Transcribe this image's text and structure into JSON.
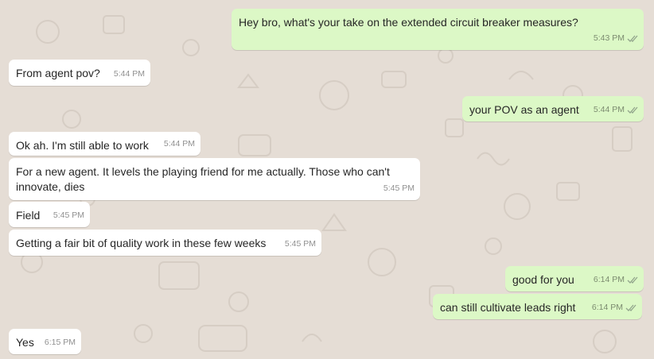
{
  "colors": {
    "background": "#e5ddd5",
    "incoming_bubble": "#ffffff",
    "outgoing_bubble": "#dcf8c6",
    "tick": "#92a58c"
  },
  "messages": [
    {
      "direction": "outgoing",
      "text": "Hey bro, what's your take on the extended circuit breaker measures?",
      "time": "5:43 PM",
      "status_icon": "double-check-icon"
    },
    {
      "direction": "incoming",
      "text": "From agent pov?",
      "time": "5:44 PM"
    },
    {
      "direction": "outgoing",
      "text": "your POV as an agent",
      "time": "5:44 PM",
      "status_icon": "double-check-icon"
    },
    {
      "direction": "incoming",
      "text": "Ok ah. I'm still able to work",
      "time": "5:44 PM"
    },
    {
      "direction": "incoming",
      "text": "For a new agent. It levels the playing friend for me actually. Those who can't innovate, dies",
      "time": "5:45 PM"
    },
    {
      "direction": "incoming",
      "text": "Field",
      "time": "5:45 PM"
    },
    {
      "direction": "incoming",
      "text": "Getting a fair bit of quality work in these few weeks",
      "time": "5:45 PM"
    },
    {
      "direction": "outgoing",
      "text": "good for you",
      "time": "6:14 PM",
      "status_icon": "double-check-icon"
    },
    {
      "direction": "outgoing",
      "text": "can still cultivate leads right",
      "time": "6:14 PM",
      "status_icon": "double-check-icon"
    },
    {
      "direction": "incoming",
      "text": "Yes",
      "time": "6:15 PM"
    }
  ]
}
